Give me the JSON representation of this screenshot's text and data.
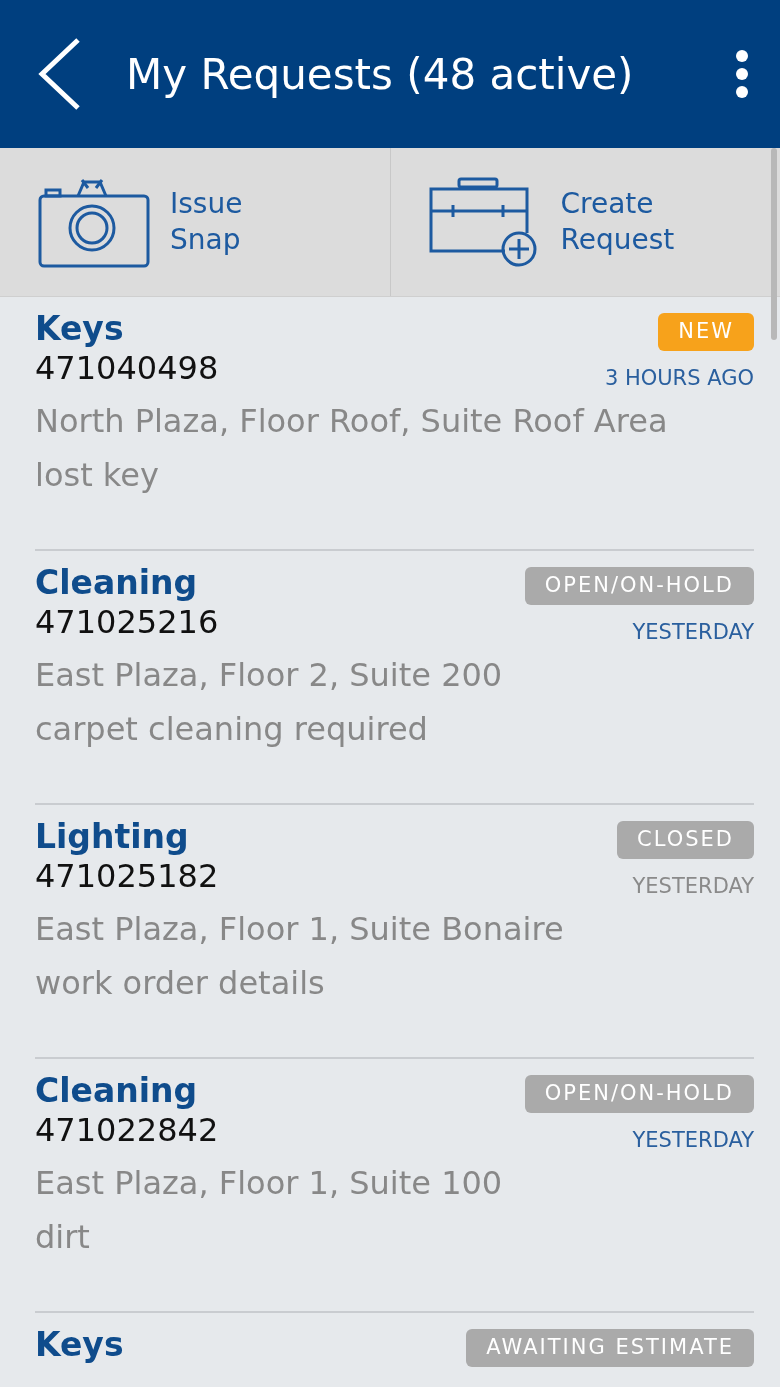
{
  "header": {
    "title": "My Requests (48 active)"
  },
  "actions": [
    {
      "kind": "snap",
      "label": "Issue\nSnap"
    },
    {
      "kind": "create",
      "label": "Create\nRequest"
    }
  ],
  "requests": [
    {
      "category": "Keys",
      "number": "471040498",
      "status": {
        "label": "NEW",
        "color": "#f7a21b"
      },
      "time": {
        "label": "3 HOURS AGO",
        "color": "#2a5f9e"
      },
      "location": "North Plaza, Floor Roof, Suite Roof Area",
      "description": "lost key"
    },
    {
      "category": "Cleaning",
      "number": "471025216",
      "status": {
        "label": "OPEN/ON-HOLD",
        "color": "#aaaaaa"
      },
      "time": {
        "label": "YESTERDAY",
        "color": "#2a5f9e"
      },
      "location": "East Plaza, Floor 2, Suite 200",
      "description": "carpet cleaning required"
    },
    {
      "category": "Lighting",
      "number": "471025182",
      "status": {
        "label": "CLOSED",
        "color": "#aaaaaa"
      },
      "time": {
        "label": "YESTERDAY",
        "color": "#8a8a8a"
      },
      "location": "East Plaza, Floor 1, Suite Bonaire",
      "description": "work order details"
    },
    {
      "category": "Cleaning",
      "number": "471022842",
      "status": {
        "label": "OPEN/ON-HOLD",
        "color": "#aaaaaa"
      },
      "time": {
        "label": "YESTERDAY",
        "color": "#2a5f9e"
      },
      "location": "East Plaza, Floor 1, Suite 100",
      "description": "dirt"
    },
    {
      "category": "Keys",
      "status": {
        "label": "AWAITING ESTIMATE",
        "color": "#aaaaaa"
      }
    }
  ]
}
